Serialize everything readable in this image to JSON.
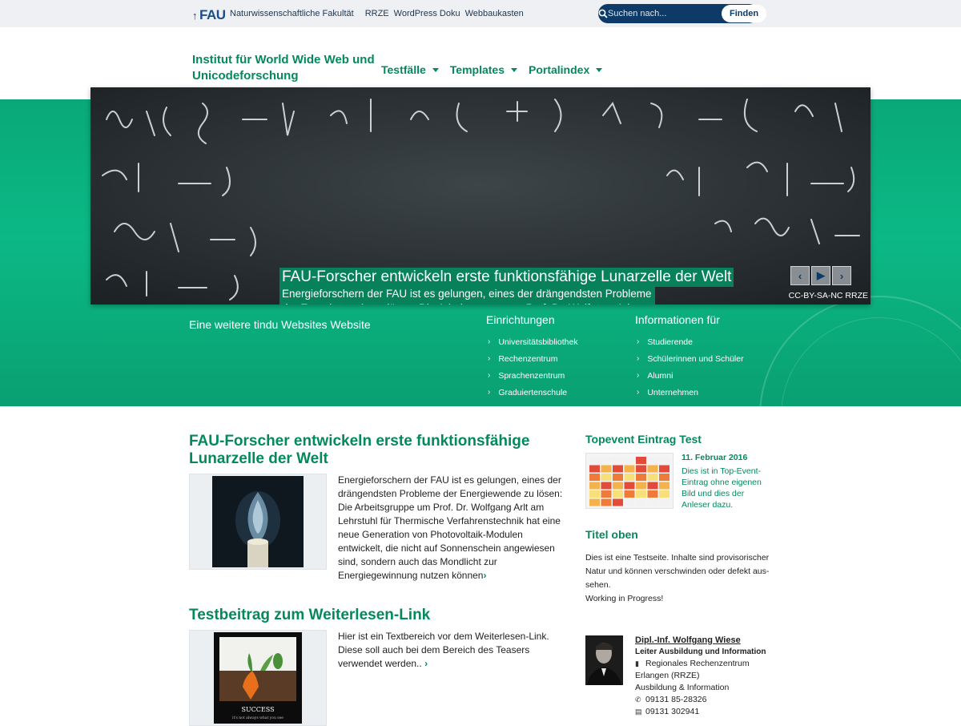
{
  "metabar": {
    "logo": "FAU",
    "links": [
      "Naturwissenschaftliche Fakultät",
      "RRZE",
      "WordPress Doku",
      "Webbaukasten"
    ],
    "search_placeholder": "Suchen nach...",
    "search_button": "Finden"
  },
  "header": {
    "site_title": "Institut für World Wide Web und Unicodeforschung",
    "nav": [
      "Testfälle",
      "Templates",
      "Portalindex"
    ]
  },
  "hero": {
    "title": "FAU-Forscher entwickeln erste funktionsfähige Lunarzelle der Welt",
    "text": "Energieforschern der FAU ist es gelungen, eines der drängendsten Probleme der Energiewende zu lösen: Die Arbeitsgruppe um Prof. Dr. Wolfgang Arlt am Lehrstuhl für Thermische Verfahrenstechnik hat eine neue Generation von Photovoltaik-Modulen entwickelt, die nicht auf Sonnenschein angewiesen sind, sondern auch das Mondlicht zur Energiegewinnung nutzen können",
    "credit": "CC-BY-SA-NC RRZE"
  },
  "band": {
    "tagline": "Eine weitere tindu Websites Website",
    "einrichtungen": {
      "title": "Einrichtungen",
      "items": [
        "Universitätsbibliothek",
        "Rechenzentrum",
        "Sprachenzentrum",
        "Graduiertenschule"
      ]
    },
    "informationen": {
      "title": "Informationen für",
      "items": [
        "Studierende",
        "Schülerinnen und Schüler",
        "Alumni",
        "Unternehmen"
      ]
    }
  },
  "posts": [
    {
      "title": "FAU-Forscher entwickeln erste funktionsfähige Lunarzelle der Welt",
      "text": "Energieforschern der FAU ist es gelungen, eines der drängendsten Probleme der Energiewende zu lösen: Die Arbeitsgruppe um Prof. Dr. Wolfgang Arlt am Lehrstuhl für Thermische Verfahrenstechnik hat eine neue Gene­ration von Photovoltaik-Modulen entwickelt, die nicht auf Sonnenschein angewiesen sind, sondern auch das Mondlicht zur Energiegewinnung nutzen können"
    },
    {
      "title": "Testbeitrag zum Weiterlesen-Link",
      "text": "Hier ist ein Textbereich vor dem Weiterlesen-Link. Diese soll auch bei dem Bereich des Teasers verwendet wer­den..",
      "image_caption": "SUCCESS",
      "image_subcaption": "it's not always what you see"
    }
  ],
  "sidebar": {
    "event_title": "Topevent Eintrag Test",
    "event_date": "11. Februar 2016",
    "event_desc": "Dies ist in Top-Event-Eintrag ohne eigenen Bild und dies der Anleser dazu.",
    "section_title": "Titel oben",
    "section_text": "Dies ist eine Testseite. Inhalte sind provisorischer Natur und können verschwinden oder defekt aus­sehen.",
    "section_text2": "Working in Progress!",
    "contact": {
      "name": "Dipl.-Inf. Wolfgang Wiese",
      "role": "Leiter Ausbildung und Information",
      "org_line1": "Regionales Rechenzentrum",
      "org_line2": "Erlangen (RRZE)",
      "org_line3": "Ausbildung & Information",
      "phone": "09131 85-28326",
      "fax": "09131 302941"
    }
  },
  "colors": {
    "brand_green": "#04895d",
    "band_green": "#0bb985",
    "fau_blue": "#0d3a66"
  }
}
